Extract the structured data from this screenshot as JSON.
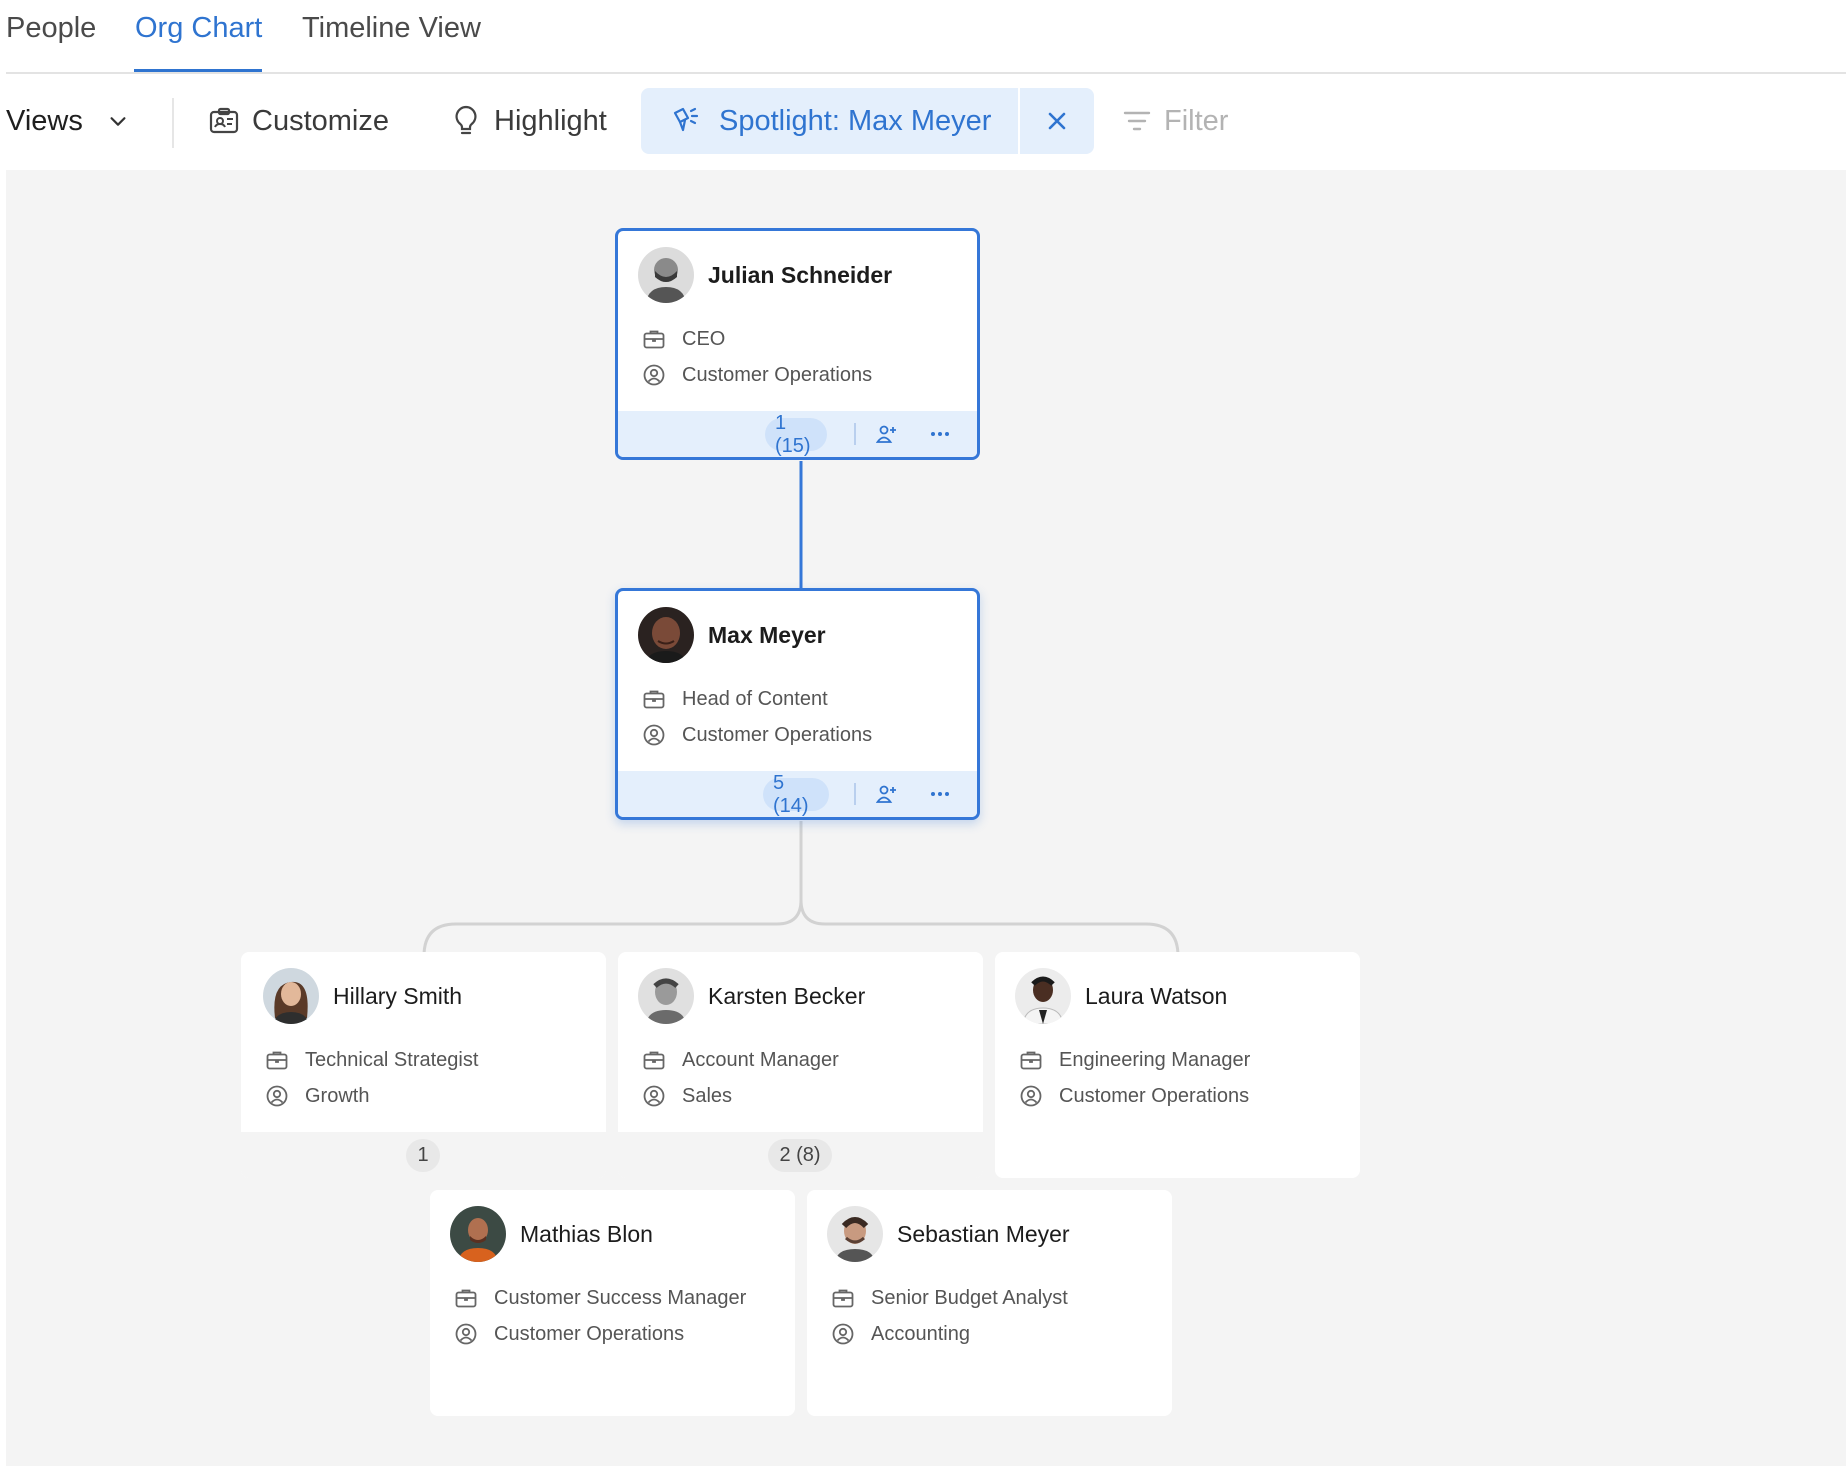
{
  "tabs": [
    {
      "label": "People",
      "active": false
    },
    {
      "label": "Org Chart",
      "active": true
    },
    {
      "label": "Timeline View",
      "active": false
    }
  ],
  "toolbar": {
    "views_label": "Views",
    "customize_label": "Customize",
    "highlight_label": "Highlight",
    "spotlight_label": "Spotlight: Max Meyer",
    "filter_label": "Filter"
  },
  "colors": {
    "accent": "#2f74d0",
    "selected_border": "#3577d8",
    "canvas": "#f4f4f4",
    "spotlight_bg": "#e4effc"
  },
  "org": {
    "ceo": {
      "name": "Julian Schneider",
      "title": "CEO",
      "department": "Customer Operations",
      "reports": "1 (15)"
    },
    "head": {
      "name": "Max Meyer",
      "title": "Head of Content",
      "department": "Customer Operations",
      "reports": "5 (14)"
    },
    "reports": [
      {
        "name": "Hillary Smith",
        "title": "Technical Strategist",
        "department": "Growth",
        "reports": "1"
      },
      {
        "name": "Karsten Becker",
        "title": "Account Manager",
        "department": "Sales",
        "reports": "2 (8)"
      },
      {
        "name": "Laura Watson",
        "title": "Engineering Manager",
        "department": "Customer Operations",
        "reports": ""
      },
      {
        "name": "Mathias Blon",
        "title": "Customer Success Manager",
        "department": "Customer Operations",
        "reports": ""
      },
      {
        "name": "Sebastian Meyer",
        "title": "Senior Budget Analyst",
        "department": "Accounting",
        "reports": ""
      }
    ]
  },
  "icons": [
    "chevron-down-icon",
    "id-card-icon",
    "lightbulb-icon",
    "spotlight-icon",
    "close-icon",
    "filter-icon",
    "briefcase-icon",
    "user-circle-icon",
    "add-person-icon",
    "more-icon"
  ]
}
